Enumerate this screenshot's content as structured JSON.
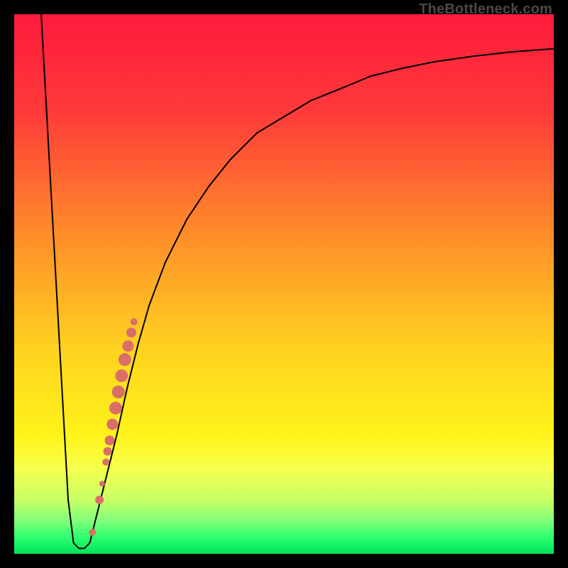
{
  "watermark": "TheBottleneck.com",
  "colors": {
    "frame": "#000000",
    "curve": "#000000",
    "marker": "#d96f68",
    "gradient_stops": [
      {
        "pct": 0,
        "color": "#ff1a3c"
      },
      {
        "pct": 18,
        "color": "#ff3a3a"
      },
      {
        "pct": 40,
        "color": "#ff8a2a"
      },
      {
        "pct": 62,
        "color": "#ffd21f"
      },
      {
        "pct": 78,
        "color": "#fff31a"
      },
      {
        "pct": 84,
        "color": "#f6ff4a"
      },
      {
        "pct": 90,
        "color": "#c8ff66"
      },
      {
        "pct": 94,
        "color": "#7fff7a"
      },
      {
        "pct": 97,
        "color": "#2dff6e"
      },
      {
        "pct": 100,
        "color": "#00e35a"
      }
    ]
  },
  "chart_data": {
    "type": "line",
    "title": "",
    "xlabel": "",
    "ylabel": "",
    "xlim": [
      0,
      100
    ],
    "ylim": [
      0,
      100
    ],
    "series": [
      {
        "name": "bottleneck-curve",
        "x": [
          5,
          6,
          7,
          8,
          9,
          10,
          11,
          12,
          13,
          14,
          15,
          17,
          19,
          21,
          23,
          25,
          28,
          32,
          36,
          40,
          45,
          50,
          55,
          60,
          66,
          72,
          78,
          85,
          92,
          100
        ],
        "y": [
          100,
          82,
          64,
          46,
          28,
          10,
          2,
          1,
          1,
          2,
          6,
          14,
          22,
          31,
          39,
          46,
          54,
          62,
          68,
          73,
          78,
          81,
          84,
          86,
          88.5,
          90,
          91.2,
          92.2,
          93,
          93.6
        ]
      }
    ],
    "markers": {
      "name": "highlight-points",
      "points": [
        {
          "x": 14.5,
          "y": 4,
          "r": 5
        },
        {
          "x": 15.8,
          "y": 10,
          "r": 6
        },
        {
          "x": 16.3,
          "y": 13,
          "r": 4
        },
        {
          "x": 17.0,
          "y": 17,
          "r": 5
        },
        {
          "x": 17.3,
          "y": 19,
          "r": 6
        },
        {
          "x": 17.7,
          "y": 21,
          "r": 7
        },
        {
          "x": 18.2,
          "y": 24,
          "r": 8
        },
        {
          "x": 18.8,
          "y": 27,
          "r": 9
        },
        {
          "x": 19.3,
          "y": 30,
          "r": 9
        },
        {
          "x": 19.9,
          "y": 33,
          "r": 9
        },
        {
          "x": 20.5,
          "y": 36,
          "r": 9
        },
        {
          "x": 21.1,
          "y": 38.5,
          "r": 8
        },
        {
          "x": 21.7,
          "y": 41,
          "r": 7
        },
        {
          "x": 22.2,
          "y": 43,
          "r": 5
        }
      ]
    }
  }
}
